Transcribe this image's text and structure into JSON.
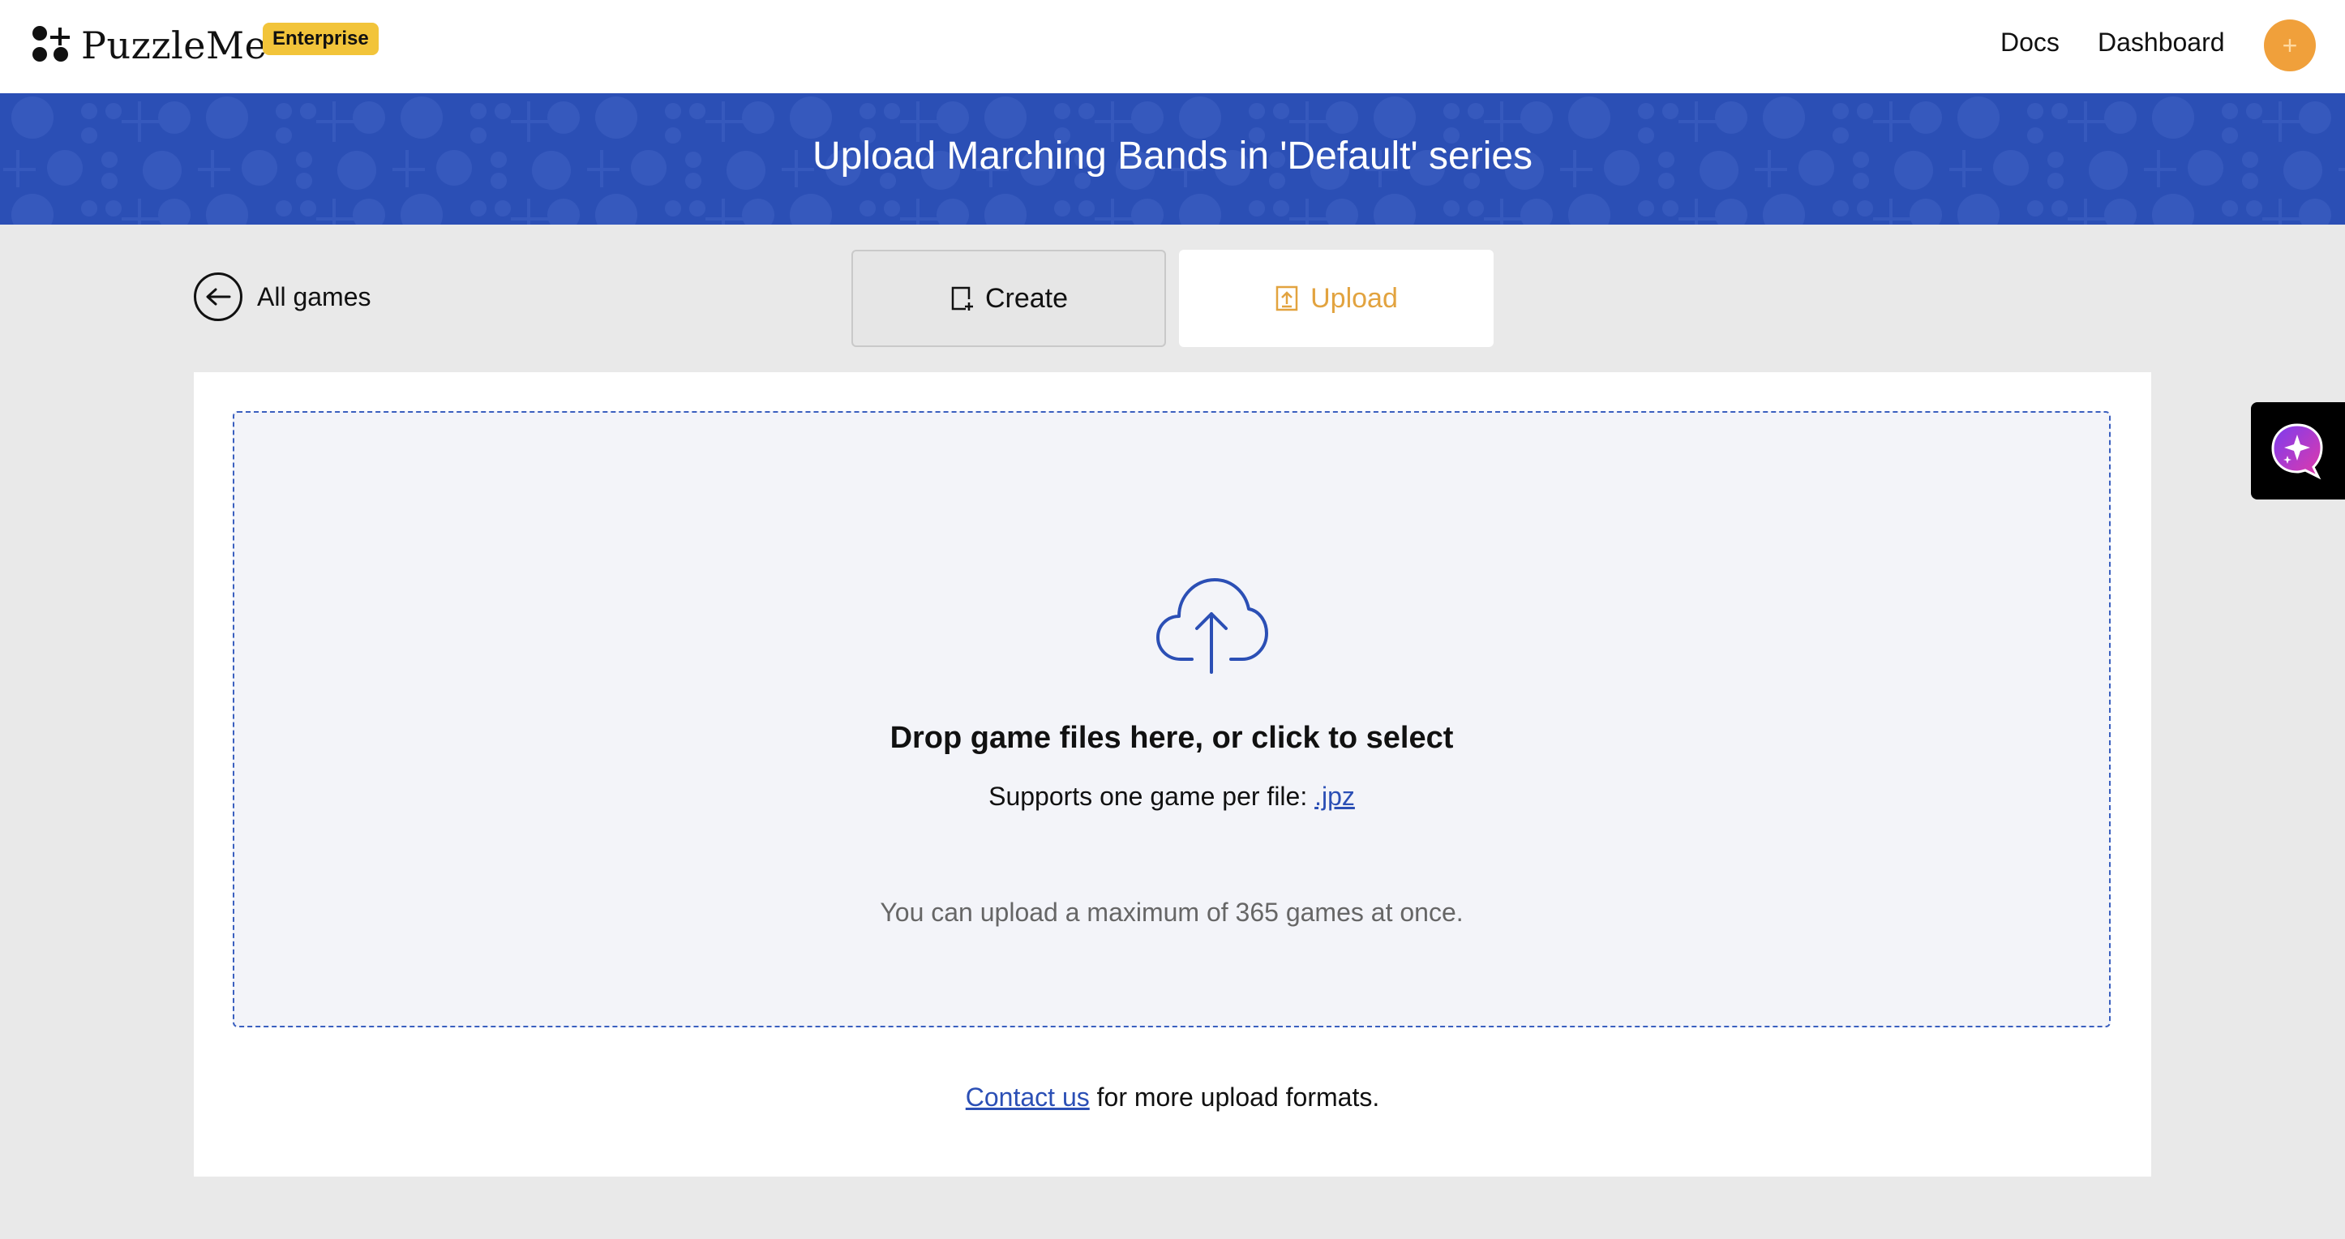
{
  "header": {
    "logo_text": "PuzzleMe",
    "badge": "Enterprise",
    "nav": {
      "docs": "Docs",
      "dashboard": "Dashboard"
    },
    "avatar_icon": "plus-icon",
    "avatar_glyph": "+"
  },
  "banner": {
    "title": "Upload Marching Bands in 'Default' series"
  },
  "back": {
    "label": "All games"
  },
  "tabs": [
    {
      "label": "Create",
      "icon": "create-doc-icon",
      "active": false
    },
    {
      "label": "Upload",
      "icon": "upload-doc-icon",
      "active": true
    }
  ],
  "dropzone": {
    "title": "Drop game files here, or click to select",
    "support_prefix": "Supports one game per file: ",
    "support_link": ".jpz",
    "max_text": "You can upload a maximum of 365 games at once."
  },
  "footer": {
    "contact_link": "Contact us",
    "contact_suffix": " for more upload formats."
  },
  "colors": {
    "banner": "#2b4fb5",
    "accent": "#e2a33f",
    "badge": "#f2c43a",
    "link": "#2b4fb5"
  }
}
